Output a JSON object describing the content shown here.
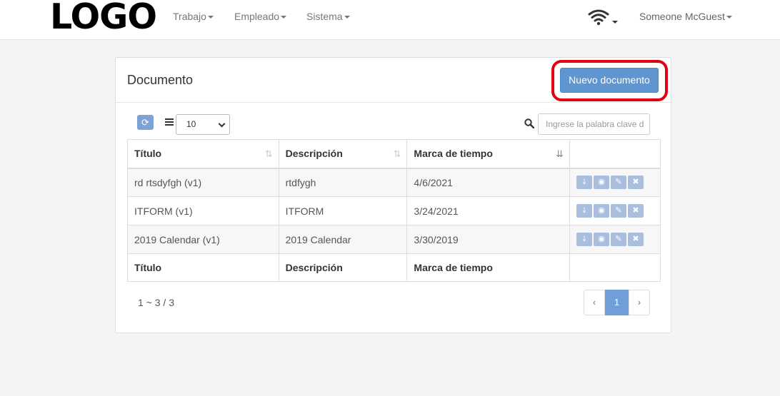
{
  "header": {
    "logo": "LOGO",
    "nav": [
      {
        "label": "Trabajo"
      },
      {
        "label": "Empleado"
      },
      {
        "label": "Sistema"
      }
    ],
    "user": "Someone McGuest"
  },
  "panel": {
    "title": "Documento",
    "new_button": "Nuevo documento",
    "page_size": "10",
    "search_placeholder": "Ingrese la palabra clave d",
    "columns": [
      "Título",
      "Descripción",
      "Marca de tiempo"
    ],
    "rows": [
      {
        "title": "rd rtsdyfgh (v1)",
        "description": "rtdfygh",
        "timestamp": "4/6/2021"
      },
      {
        "title": "ITFORM (v1)",
        "description": "ITFORM",
        "timestamp": "3/24/2021"
      },
      {
        "title": "2019 Calendar (v1)",
        "description": "2019 Calendar",
        "timestamp": "3/30/2019"
      }
    ],
    "summary": "1 ~ 3 / 3",
    "pager": {
      "prev": "‹",
      "current": "1",
      "next": "›"
    }
  },
  "colors": {
    "primary": "#5f95d0",
    "highlight": "#e0000f",
    "action": "#a9bfdd"
  }
}
